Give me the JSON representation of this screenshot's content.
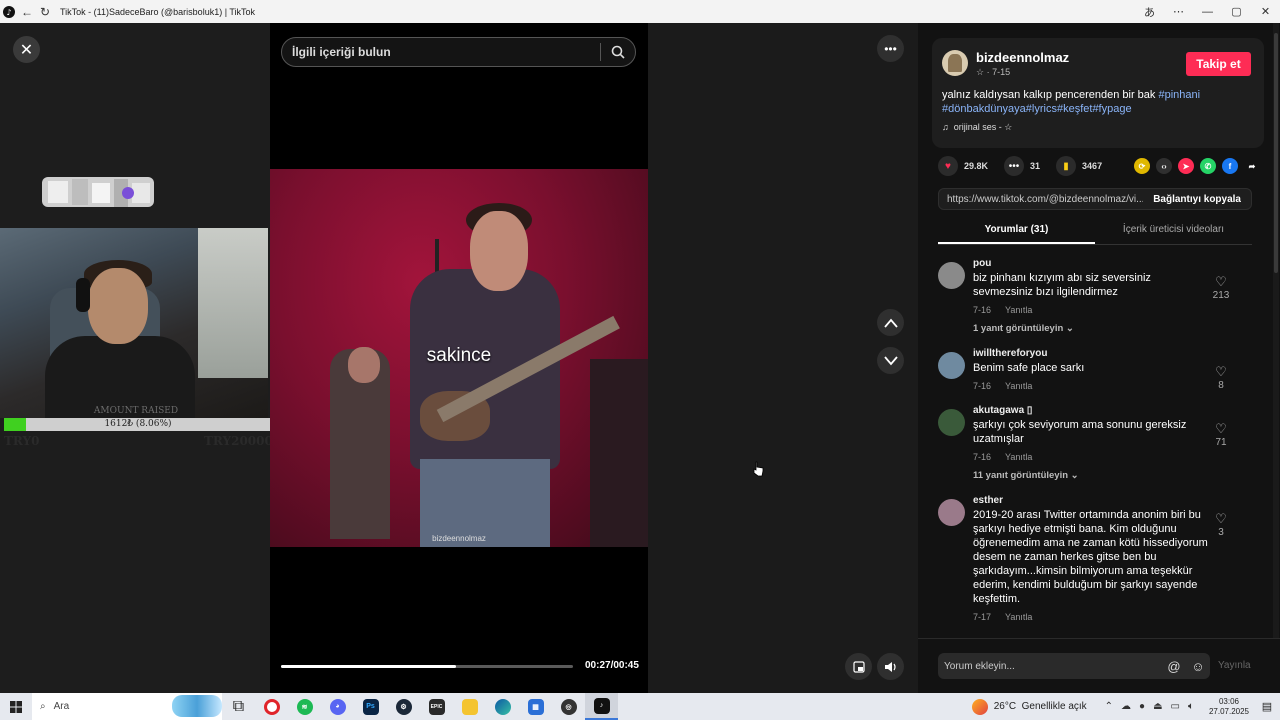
{
  "browser": {
    "tab_title": "TikTok - (11)SadeceBaro (@barisboluk1) | TikTok"
  },
  "stream": {
    "goal_label": "AMOUNT RAISED",
    "goal_progress_text": "1612₺ (8.06%)",
    "goal_fraction": 0.0806,
    "goal_min": "TRY0",
    "goal_max": "TRY20000"
  },
  "video": {
    "search_placeholder": "İlgili içeriği bulun",
    "caption": "sakince",
    "watermark": "bizdeennolmaz",
    "current_time": "00:27/00:45",
    "progress_fraction": 0.6
  },
  "creator": {
    "username": "bizdeennolmaz",
    "meta": "☆ · 7-15",
    "follow_label": "Takip et",
    "description": "yalnız kaldıysan kalkıp pencerenden bir bak",
    "hashtags": [
      "#pinhani",
      "#dönbakdünyaya",
      "#lyrics",
      "#keşfet",
      "#fypage"
    ],
    "sound": "orijinal ses - ☆"
  },
  "stats": {
    "likes": "29.8K",
    "comments": "31",
    "saves": "3467"
  },
  "share": {
    "link": "https://www.tiktok.com/@bizdeennolmaz/vi...",
    "copy_label": "Bağlantıyı kopyala"
  },
  "tabs": {
    "comments": "Yorumlar (31)",
    "creator_videos": "İçerik üreticisi videoları"
  },
  "comments": [
    {
      "user": "pou",
      "text": "biz pinhanı kızıyım abı siz seversiniz sevmezsiniz bızı ilgilendirmez",
      "date": "7-16",
      "reply": "Yanıtla",
      "replies": "1 yanıt görüntüleyin",
      "likes": "213"
    },
    {
      "user": "iwillthereforyou",
      "text": "Benim safe place sarkı",
      "date": "7-16",
      "reply": "Yanıtla",
      "replies": "",
      "likes": "8"
    },
    {
      "user": "akutagawa ▯",
      "text": "şarkıyı çok seviyorum ama sonunu gereksiz uzatmışlar",
      "date": "7-16",
      "reply": "Yanıtla",
      "replies": "11 yanıt görüntüleyin",
      "likes": "71"
    },
    {
      "user": "esther",
      "text": "2019-20 arası Twitter ortamında anonim biri bu şarkıyı hediye etmişti bana. Kim olduğunu öğrenemedim ama ne zaman kötü hissediyorum desem ne zaman herkes gitse ben bu şarkıdayım...kimsin bilmiyorum ama teşekkür ederim, kendimi bulduğum bir şarkıyı sayende keşfettim.",
      "date": "7-17",
      "reply": "Yanıtla",
      "replies": "",
      "likes": "3"
    }
  ],
  "comment_box": {
    "placeholder": "Yorum ekleyin...",
    "post_label": "Yayınla"
  },
  "taskbar": {
    "search_label": "Ara",
    "weather": "26°C",
    "weather_desc": "Genellikle açık",
    "time": "03:06",
    "date": "27.07.2025"
  },
  "colors": {
    "accent": "#fe2c55",
    "hashtag": "#8ab4f8"
  }
}
